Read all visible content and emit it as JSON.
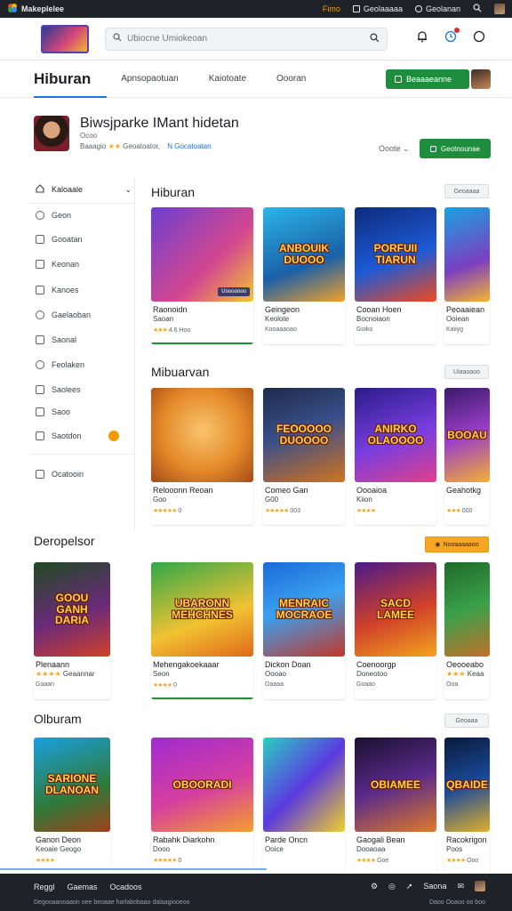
{
  "topbar": {
    "app_name": "Makeplelee",
    "pill1": "Fimo",
    "pill2": "Geolaaaaa",
    "pill3": "Geolanan"
  },
  "header": {
    "search_placeholder": "Ubiocne Umiokeoan"
  },
  "nav": {
    "brand": "Hiburan",
    "tabs": [
      "Apnsopaotuan",
      "Kaiotoate",
      "Oooran"
    ],
    "cta_label": "Beaaaeanne"
  },
  "profile": {
    "name": "Biwsjparke IMant hidetan",
    "line1": "Ocoo",
    "line2_a": "Baaagio",
    "line2_stars": "★★",
    "line2_b": "Geoatoator,",
    "line2_link": "N Gocatoatan",
    "sort_label": "Ooote",
    "button_label": "Geotnounae"
  },
  "sidebar": {
    "header": "Kaloaale",
    "items": [
      "Geon",
      "Gooatan",
      "Keonan",
      "Kanoes",
      "Gaelaoban",
      "Saonal",
      "Feolaken",
      "Saolees",
      "Saoo",
      "Saotdon",
      "Ocatooin"
    ]
  },
  "sections": [
    {
      "title": "Hiburan",
      "more": "Geoaaaa",
      "cards": [
        {
          "art": "",
          "tag": "Uooooooo",
          "title": "Raonoidn",
          "sub": "Saoan",
          "rating": "4.6 Hoo"
        },
        {
          "art": "ANBOUIK\nDUOOO",
          "tag": "",
          "title": "Geingeon",
          "sub": "Keolote",
          "rating": "Kooaaaoao"
        },
        {
          "art": "PORFUII\nTIARUN",
          "tag": "",
          "title": "Cooan Hoen",
          "sub": "Bocnoiaon",
          "rating": "Goiko"
        },
        {
          "art": "",
          "tag": "",
          "title": "Peoaaiean",
          "sub": "Ooiean",
          "rating": "Kaiiyg"
        }
      ]
    },
    {
      "title": "Mibuarvan",
      "more": "Uiaaoaoo",
      "cards": [
        {
          "art": "",
          "tag": "",
          "title": "Relooonn Reoan",
          "sub": "Goo",
          "rating": "0"
        },
        {
          "art": "FEOOOOO\nDUOOOO",
          "tag": "",
          "title": "Comeo Gan",
          "sub": "G00",
          "rating": "003"
        },
        {
          "art": "ANIRKO\nOLAOOOO",
          "tag": "",
          "title": "Oooaioa",
          "sub": "Kiion",
          "rating": ""
        },
        {
          "art": "BOOAU",
          "tag": "",
          "title": "Geahotkg",
          "sub": "",
          "rating": "000"
        }
      ]
    },
    {
      "title": "Deropelsor",
      "more": "Nooaaaaaoo",
      "cards": [
        {
          "art": "GOOU\nGANH\nDARIA",
          "tag": "",
          "title": "Plenaann",
          "sub": "Geaannar",
          "rating": "Gaaan"
        },
        {
          "art": "UBARONN\nMEHCHNES",
          "tag": "",
          "title": "Mehengakoekaaar",
          "sub": "Seon",
          "rating": "0"
        },
        {
          "art": "MENRAIC\nMOCRAOE",
          "tag": "",
          "title": "Dickon Doan",
          "sub": "Oooao",
          "rating": "Oaaaa"
        },
        {
          "art": "SACD\nLAMEE",
          "tag": "",
          "title": "Coenoorgp",
          "sub": "Doneotoo",
          "rating": "Goaao"
        },
        {
          "art": "",
          "tag": "",
          "title": "Oeooeabo",
          "sub": "Keaa",
          "rating": "Ooa"
        }
      ]
    },
    {
      "title": "Olburam",
      "more": "Geoaaa",
      "cards": [
        {
          "art": "SARIONE\nDLANOAN",
          "tag": "",
          "title": "Ganon Deon",
          "sub": "Keoaie Geogo",
          "rating": ""
        },
        {
          "art": "OBOORADI",
          "tag": "",
          "title": "Rabahk Diarkohn",
          "sub": "Dooo",
          "rating": "0"
        },
        {
          "art": "",
          "tag": "",
          "title": "Parde Oncn",
          "sub": "Ooice",
          "rating": ""
        },
        {
          "art": "OBIAMEE",
          "tag": "",
          "title": "Gaogali Bean",
          "sub": "Dooaoaa",
          "rating": "Goe"
        },
        {
          "art": "QBAIDE",
          "tag": "",
          "title": "Racokrigon",
          "sub": "Poos",
          "rating": "Ooo"
        }
      ]
    }
  ],
  "footer": {
    "links": [
      "Reggl",
      "Gaemas",
      "Ocadoos"
    ],
    "right_label": "Saona",
    "copyright": "Degooaanoaaon oee beoaae harlabobaao dalaagiooeoo",
    "right_small": "Daoo Ooaoo oo boo"
  },
  "colors": {
    "accent_green": "#1e8e3e",
    "accent_blue": "#1a73e8",
    "star": "#f5a623",
    "dark_bar": "#1f2328"
  }
}
